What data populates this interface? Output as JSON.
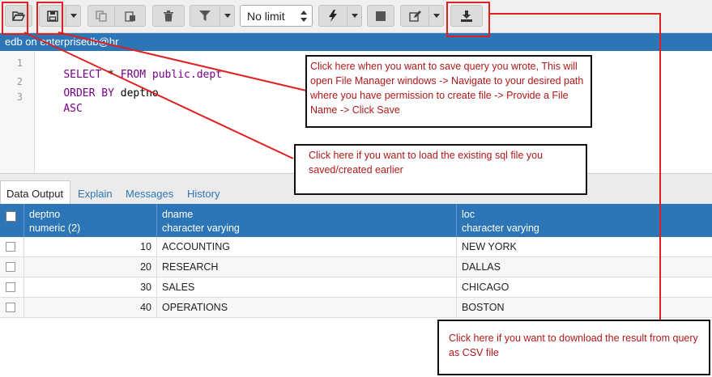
{
  "toolbar": {
    "limit_value": "No limit"
  },
  "query_tab": {
    "title": "edb on enterprisedb@hr"
  },
  "editor": {
    "lines": [
      {
        "num": "1",
        "parts": [
          {
            "k": "kw",
            "t": "SELECT "
          },
          {
            "k": "plain",
            "t": "* "
          },
          {
            "k": "kw",
            "t": "FROM "
          },
          {
            "k": "obj",
            "t": "public.dept"
          }
        ]
      },
      {
        "num": "2",
        "parts": [
          {
            "k": "kw",
            "t": "ORDER BY "
          },
          {
            "k": "plain",
            "t": "deptno"
          }
        ]
      },
      {
        "num": "3",
        "parts": [
          {
            "k": "kw",
            "t": "ASC"
          }
        ]
      }
    ]
  },
  "result_tabs": {
    "data_output": "Data Output",
    "explain": "Explain",
    "messages": "Messages",
    "history": "History"
  },
  "grid": {
    "columns": [
      {
        "name": "deptno",
        "type": "numeric (2)"
      },
      {
        "name": "dname",
        "type": "character varying"
      },
      {
        "name": "loc",
        "type": "character varying"
      }
    ],
    "rows": [
      {
        "deptno": "10",
        "dname": "ACCOUNTING",
        "loc": "NEW YORK"
      },
      {
        "deptno": "20",
        "dname": "RESEARCH",
        "loc": "DALLAS"
      },
      {
        "deptno": "30",
        "dname": "SALES",
        "loc": "CHICAGO"
      },
      {
        "deptno": "40",
        "dname": "OPERATIONS",
        "loc": "BOSTON"
      }
    ]
  },
  "annotations": {
    "save": "Click here when you want to save query you wrote, This will open File Manager windows ->  Navigate to your desired path where you have permission to create file -> Provide a File Name -> Click Save",
    "load": "Click here if you want to load the existing sql file you saved/created earlier",
    "download": "Click here if you want to download the result from query as CSV file"
  },
  "colors": {
    "accent": "#2c76b7",
    "annotation_red": "#e02020",
    "annotation_text": "#b01818"
  }
}
